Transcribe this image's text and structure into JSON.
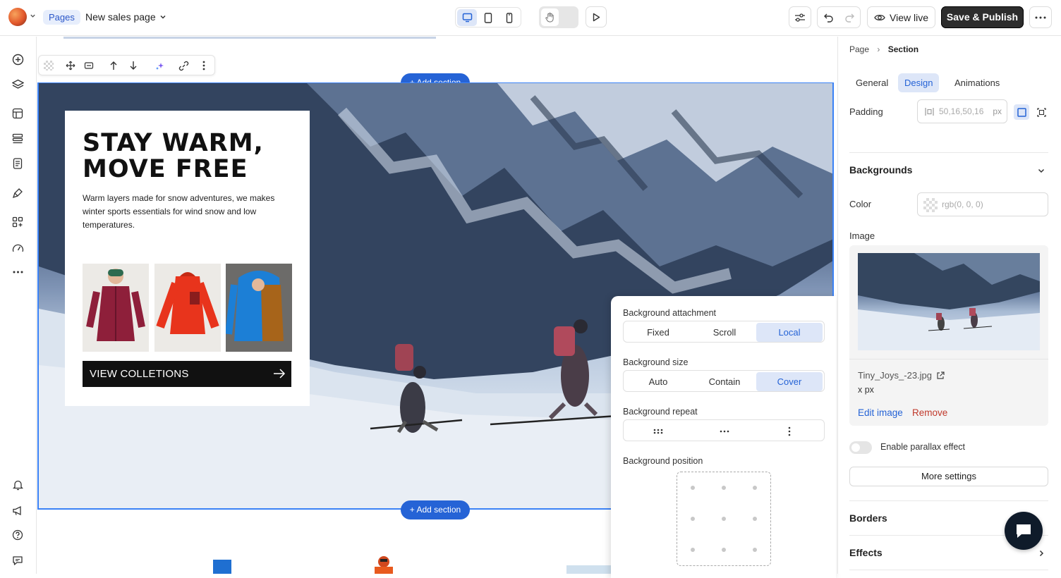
{
  "topbar": {
    "pages_label": "Pages",
    "page_name": "New sales page",
    "view_live": "View live",
    "save_publish": "Save & Publish"
  },
  "canvas": {
    "add_section_label": "+ Add section",
    "hero": {
      "title_line1": "STAY WARM,",
      "title_line2": "MOVE FREE",
      "description": "Warm layers made for snow adventures, we makes winter sports essentials for wind snow and low temperatures.",
      "cta_label": "VIEW COLLETIONS"
    }
  },
  "background_popover": {
    "attachment": {
      "label": "Background attachment",
      "options": [
        "Fixed",
        "Scroll",
        "Local"
      ],
      "selected": "Local"
    },
    "size": {
      "label": "Background size",
      "options": [
        "Auto",
        "Contain",
        "Cover"
      ],
      "selected": "Cover"
    },
    "repeat": {
      "label": "Background repeat"
    },
    "position": {
      "label": "Background position"
    }
  },
  "right_panel": {
    "breadcrumb": [
      "Page",
      "Section"
    ],
    "tabs": [
      "General",
      "Design",
      "Animations"
    ],
    "active_tab": "Design",
    "padding": {
      "label": "Padding",
      "placeholder": "50,16,50,16",
      "unit": "px"
    },
    "backgrounds": {
      "title": "Backgrounds",
      "color_label": "Color",
      "color_placeholder": "rgb(0, 0, 0)",
      "image_label": "Image",
      "file_name": "Tiny_Joys_-23.jpg",
      "dimensions": "x px",
      "edit_image": "Edit image",
      "remove": "Remove",
      "parallax_label": "Enable parallax effect",
      "more_settings": "More settings"
    },
    "borders_title": "Borders",
    "effects_title": "Effects"
  },
  "colors": {
    "accent": "#2563d6",
    "remove": "#c0392b",
    "publish_bg": "#2d2d2d"
  }
}
